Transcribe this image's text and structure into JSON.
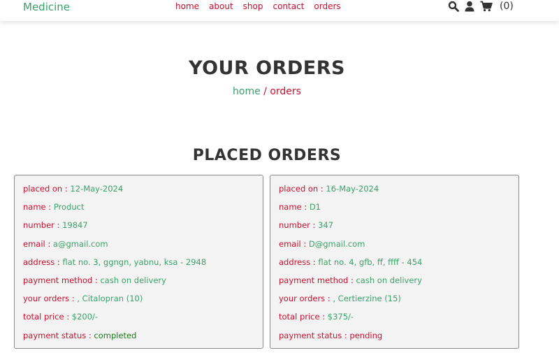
{
  "header": {
    "logo": "Medicine",
    "nav": [
      "home",
      "about",
      "shop",
      "contact",
      "orders"
    ],
    "cart_count": "(0)",
    "icons": [
      "search-icon",
      "user-icon",
      "cart-icon"
    ]
  },
  "page": {
    "title": "YOUR ORDERS",
    "breadcrumb_home": "home",
    "breadcrumb_sep": " / ",
    "breadcrumb_current": "orders",
    "section_title": "PLACED ORDERS"
  },
  "labels": {
    "placed_on": "placed on : ",
    "name": "name : ",
    "number": "number : ",
    "email": "email : ",
    "address": "address : ",
    "payment_method": "payment method : ",
    "your_orders": "your orders : ",
    "total_price": "total price : ",
    "payment_status": "payment status : "
  },
  "orders": [
    {
      "placed_on": "12-May-2024",
      "name": "Product",
      "number": "19847",
      "email": "a@gmail.com",
      "address": "flat no. 3, ggngn, yabnu, ksa - 2948",
      "payment_method": "cash on delivery",
      "your_orders": ", Citalopran (10)",
      "total_price": "$200/-",
      "payment_status": "completed"
    },
    {
      "placed_on": "16-May-2024",
      "name": "D1",
      "number": "347",
      "email": "D@gmail.com",
      "address": "flat no. 4, gfb, ff, ffff - 454",
      "payment_method": "cash on delivery",
      "your_orders": ", Certierzine (15)",
      "total_price": "$375/-",
      "payment_status": "pending"
    }
  ],
  "colors": {
    "accent_green": "#3aa26c",
    "accent_red": "#c8102e",
    "status_completed": "#1a7a1a"
  }
}
